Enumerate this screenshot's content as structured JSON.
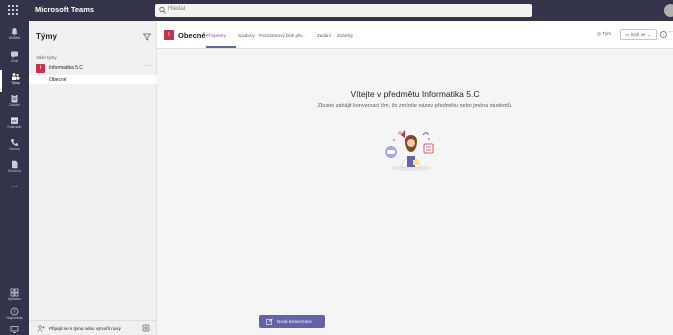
{
  "app": {
    "title": "Microsoft Teams"
  },
  "search": {
    "placeholder": "Hledat"
  },
  "user": {
    "initials": ""
  },
  "rail": [
    {
      "label": "Aktivita",
      "icon": "bell-icon"
    },
    {
      "label": "Chat",
      "icon": "chat-icon"
    },
    {
      "label": "Týmy",
      "icon": "teams-icon"
    },
    {
      "label": "Zadání",
      "icon": "assignments-icon"
    },
    {
      "label": "Kalendář",
      "icon": "calendar-icon"
    },
    {
      "label": "Hovory",
      "icon": "phone-icon"
    },
    {
      "label": "Soubory",
      "icon": "files-icon"
    },
    {
      "label": "...",
      "icon": "more-icon"
    },
    {
      "label": "Aplikace",
      "icon": "apps-icon"
    },
    {
      "label": "Nápověda",
      "icon": "help-icon"
    }
  ],
  "teams_pane": {
    "title": "Týmy",
    "section_label": "Vaše týmy",
    "team": {
      "name": "Informatika 5.C",
      "avatar": "I"
    },
    "channel": "Obecné",
    "footer": "Připojit se k týmu nebo vytvořit nový"
  },
  "channel_header": {
    "title": "Obecné",
    "avatar": "I",
    "tabs": [
      "Příspěvky",
      "Soubory",
      "Poznámkový blok pře...",
      "Zadání",
      "Známky"
    ],
    "team_button": "Tým",
    "meet_button": "Sejít se",
    "more": "···"
  },
  "main": {
    "welcome_title": "Vítejte v předmětu Informatika 5.C",
    "welcome_subtitle": "Zkuste zahájit konverzaci tím, že zmíníte název předmětu nebo jména studentů.",
    "new_conversation": "Nová konverzace"
  },
  "colors": {
    "accent": "#6264a7",
    "rail": "#33344a",
    "team_avatar": "#c4314b"
  }
}
